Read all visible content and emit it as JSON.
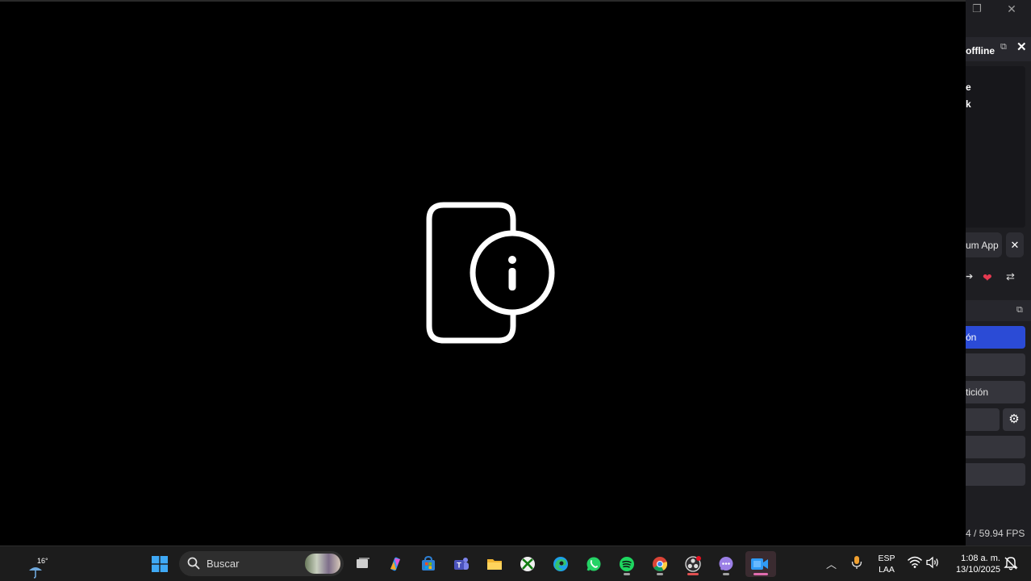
{
  "right_app": {
    "dock_title": "offline",
    "dock_line_1": "e",
    "dock_line_2": "k",
    "app_tab_label": "um App",
    "app_tab_close": "✕",
    "controls": {
      "start_stream": "ón",
      "replay": "tición"
    },
    "status": "4 / 59.94 FPS"
  },
  "taskbar": {
    "weather_temp": "16°",
    "search_placeholder": "Buscar",
    "language_line1": "ESP",
    "language_line2": "LAA",
    "time": "1:08 a. m.",
    "date": "13/10/2025",
    "icons": [
      "windows-start-icon",
      "search-icon",
      "task-view-icon",
      "copilot-icon",
      "store-icon",
      "teams-icon",
      "file-explorer-icon",
      "xbox-icon",
      "edge-icon",
      "whatsapp-icon",
      "spotify-icon",
      "chrome-icon",
      "obs-icon",
      "chat-icon",
      "screen-recorder-icon"
    ]
  },
  "colors": {
    "accent_blue": "#2b4bd6",
    "taskbar_bg": "#1c1c1c",
    "obs_panel_bg": "#1e1e22"
  }
}
